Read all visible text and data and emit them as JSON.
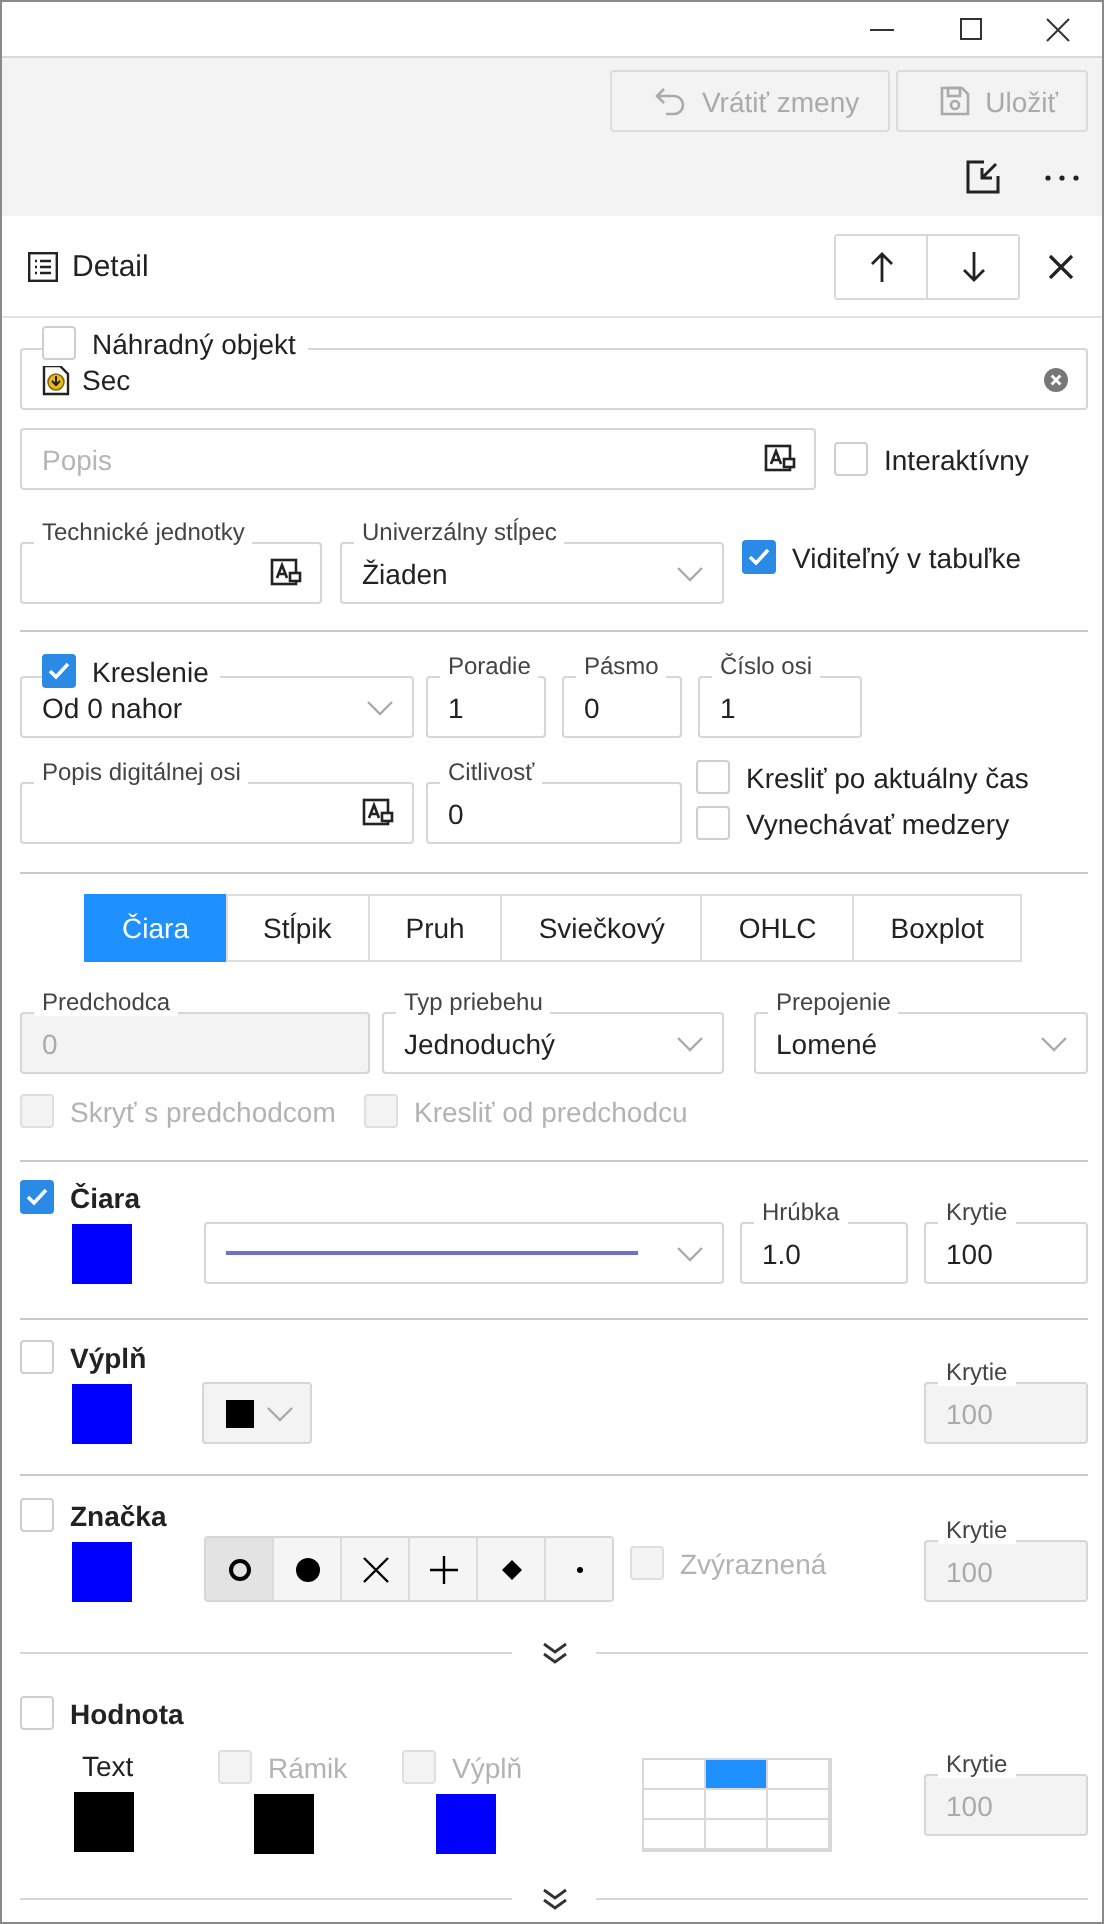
{
  "toolbar": {
    "buttons": [
      {
        "kind": "undo",
        "label": "Vrátiť zmeny",
        "disabled": true
      },
      {
        "kind": "save",
        "label": "Uložiť",
        "disabled": true
      }
    ]
  },
  "panel": {
    "title": "Detail"
  },
  "substitute_object": {
    "label": "Náhradný objekt",
    "checked": false,
    "value": "Sec"
  },
  "description": {
    "placeholder": "Popis"
  },
  "interactive": {
    "label": "Interaktívny",
    "checked": false
  },
  "technical_units": {
    "label": "Technické jednotky"
  },
  "universal_column": {
    "label": "Univerzálny stĺpec",
    "value": "Žiaden"
  },
  "visible_in_table": {
    "label": "Viditeľný v tabuľke",
    "checked": true
  },
  "drawing": {
    "label": "Kreslenie",
    "checked": true,
    "value": "Od 0 nahor"
  },
  "order": {
    "label": "Poradie",
    "value": "1"
  },
  "band": {
    "label": "Pásmo",
    "value": "0"
  },
  "axis_number": {
    "label": "Číslo osi",
    "value": "1"
  },
  "digital_axis_label": {
    "label": "Popis digitálnej osi"
  },
  "sensitivity": {
    "label": "Citlivosť",
    "value": "0"
  },
  "options": [
    {
      "label": "Kresliť po aktuálny čas",
      "checked": false
    },
    {
      "label": "Vynechávať medzery",
      "checked": false
    }
  ],
  "series_tabs": [
    {
      "label": "Čiara",
      "selected": true
    },
    {
      "label": "Stĺpik",
      "selected": false
    },
    {
      "label": "Pruh",
      "selected": false
    },
    {
      "label": "Sviečkový",
      "selected": false
    },
    {
      "label": "OHLC",
      "selected": false
    },
    {
      "label": "Boxplot",
      "selected": false
    }
  ],
  "predecessor": {
    "label": "Predchodca",
    "value": "0",
    "disabled": true
  },
  "trace_type": {
    "label": "Typ priebehu",
    "value": "Jednoduchý"
  },
  "connection": {
    "label": "Prepojenie",
    "value": "Lomené"
  },
  "predecessor_options": [
    {
      "label": "Skryť s predchodcom",
      "checked": false,
      "disabled": true
    },
    {
      "label": "Kresliť od predchodcu",
      "checked": false,
      "disabled": true
    }
  ],
  "line": {
    "label": "Čiara",
    "checked": true,
    "color": "#0000ff",
    "thickness": {
      "label": "Hrúbka",
      "value": "1.0"
    },
    "opacity": {
      "label": "Krytie",
      "value": "100",
      "disabled": false
    }
  },
  "fill": {
    "label": "Výplň",
    "checked": false,
    "color": "#0000ff",
    "opacity": {
      "label": "Krytie",
      "value": "100",
      "disabled": true
    }
  },
  "marker": {
    "label": "Značka",
    "checked": false,
    "color": "#0000ff",
    "shapes": [
      {
        "kind": "ring",
        "selected": true
      },
      {
        "kind": "dot",
        "selected": false
      },
      {
        "kind": "cross",
        "selected": false
      },
      {
        "kind": "plus",
        "selected": false
      },
      {
        "kind": "diamond",
        "selected": false
      },
      {
        "kind": "point",
        "selected": false
      }
    ],
    "highlighted": {
      "label": "Zvýraznená",
      "checked": false,
      "disabled": true
    },
    "opacity": {
      "label": "Krytie",
      "value": "100",
      "disabled": true
    }
  },
  "value_label": {
    "label": "Hodnota",
    "checked": false,
    "text": {
      "label": "Text",
      "color": "#000000"
    },
    "frame": {
      "label": "Rámik",
      "checked": false,
      "disabled": true,
      "color": "#000000"
    },
    "background": {
      "label": "Výplň",
      "checked": false,
      "disabled": true,
      "color": "#0000ff"
    },
    "position": [
      {
        "selected": false
      },
      {
        "selected": true
      },
      {
        "selected": false
      },
      {
        "selected": false
      },
      {
        "selected": false
      },
      {
        "selected": false
      },
      {
        "selected": false
      },
      {
        "selected": false
      },
      {
        "selected": false
      }
    ],
    "opacity": {
      "label": "Krytie",
      "value": "100",
      "disabled": true
    }
  }
}
